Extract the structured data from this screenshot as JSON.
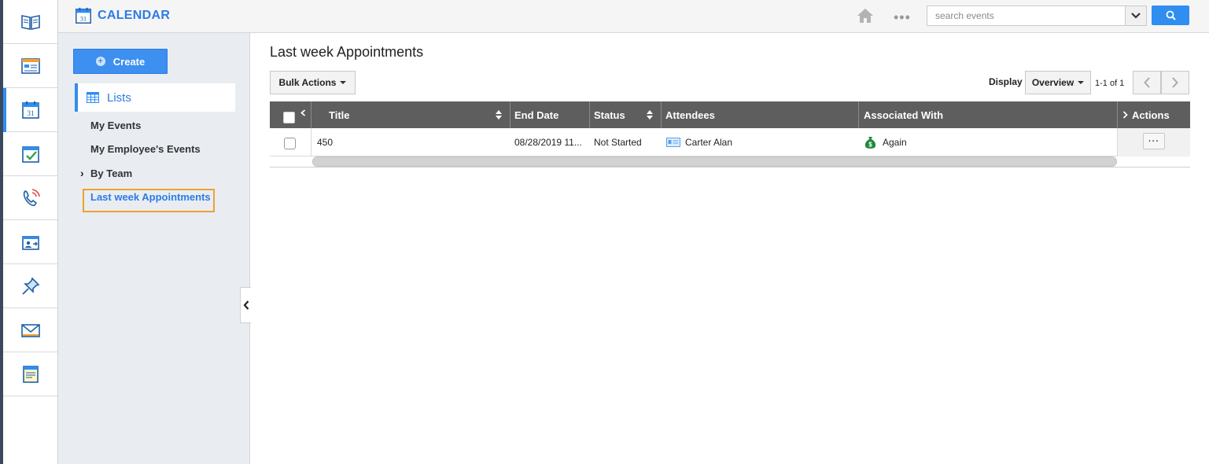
{
  "app": {
    "title": "CALENDAR",
    "calendar_badge": "31"
  },
  "header": {
    "search": {
      "placeholder": "search events",
      "value": ""
    },
    "more_label": "•••"
  },
  "rail": {
    "items": [
      {
        "icon": "book-icon"
      },
      {
        "icon": "dashboard-icon"
      },
      {
        "icon": "calendar-icon",
        "active": true,
        "badge": "31"
      },
      {
        "icon": "task-check-icon"
      },
      {
        "icon": "phone-call-icon"
      },
      {
        "icon": "contact-card-icon"
      },
      {
        "icon": "pin-icon"
      },
      {
        "icon": "mail-icon"
      },
      {
        "icon": "notes-icon"
      }
    ]
  },
  "sidebar": {
    "create_label": "Create",
    "lists_label": "Lists",
    "links": {
      "my_events": "My Events",
      "employee_events": "My Employee's Events",
      "by_team": "By Team",
      "last_week": "Last week Appointments"
    }
  },
  "main": {
    "title": "Last week Appointments",
    "bulk_actions_label": "Bulk Actions",
    "display_label": "Display",
    "display_value": "Overview",
    "pager_text": "1-1 of 1",
    "columns": {
      "title": "Title",
      "end_date": "End Date",
      "status": "Status",
      "attendees": "Attendees",
      "associated_with": "Associated With",
      "actions": "Actions"
    },
    "rows": [
      {
        "title": "450",
        "end_date": "08/28/2019 11...",
        "status": "Not Started",
        "attendee": "Carter Alan",
        "associated_with": "Again"
      }
    ]
  },
  "colors": {
    "accent": "#2f8ef0",
    "title_blue": "#2c7be5",
    "grid_header": "#5e5e5e",
    "highlight_border": "#f0a030"
  }
}
